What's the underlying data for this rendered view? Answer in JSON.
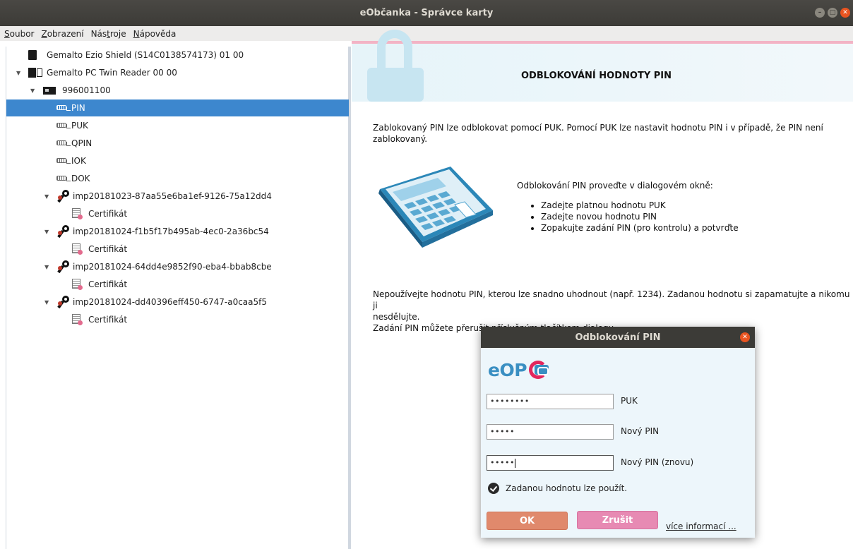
{
  "window": {
    "title": "eObčanka - Správce karty"
  },
  "menu": [
    {
      "key": "S",
      "rest": "oubor"
    },
    {
      "key": "Z",
      "rest": "obrazení"
    },
    {
      "pre": "Nás",
      "key": "t",
      "rest": "roje"
    },
    {
      "key": "N",
      "rest": "ápověda"
    }
  ],
  "tree": {
    "reader1": "Gemalto Ezio Shield (S14C0138574173) 01 00",
    "reader2": "Gemalto PC Twin Reader 00 00",
    "card": "996001100",
    "pins": [
      "PIN",
      "PUK",
      "QPIN",
      "IOK",
      "DOK"
    ],
    "keys": [
      {
        "name": "imp20181023-87aa55e6ba1ef-9126-75a12dd4",
        "cert": "Certifikát"
      },
      {
        "name": "imp20181024-f1b5f17b495ab-4ec0-2a36bc54",
        "cert": "Certifikát"
      },
      {
        "name": "imp20181024-64dd4e9852f90-eba4-bbab8cbe",
        "cert": "Certifikát"
      },
      {
        "name": "imp20181024-dd40396eff450-6747-a0caa5f5",
        "cert": "Certifikát"
      }
    ]
  },
  "content": {
    "title": "ODBLOKOVÁNÍ HODNOTY PIN",
    "intro_line1": "Zablokovaný PIN lze odblokovat pomocí PUK. Pomocí PUK lze nastavit hodnotu PIN i v případě, že PIN není",
    "intro_line2": "zablokovaný.",
    "steps_title": "Odblokování PIN proveďte v dialogovém okně:",
    "steps": [
      "Zadejte platnou hodnotu PUK",
      "Zadejte novou hodnotu PIN",
      "Zopakujte zadání PIN (pro kontrolu) a potvrďte"
    ],
    "warn_line1": "Nepoužívejte hodnotu PIN, kterou lze snadno uhodnout (např. 1234). Zadanou hodnotu si zapamatujte a nikomu ji",
    "warn_line2": "nesdělujte.",
    "warn_line3": "Zadání PIN můžete přerušit příslušným tlačítkem dialogu."
  },
  "dialog": {
    "title": "Odblokování PIN",
    "logo_text": "eOP",
    "puk_value": "••••••••",
    "puk_label": "PUK",
    "pin_value": "•••••",
    "pin_label": "Nový PIN",
    "pin2_value": "•••••",
    "pin2_label": "Nový PIN (znovu)",
    "status": "Zadanou hodnotu lze použít.",
    "ok": "OK",
    "cancel": "Zrušit",
    "more": "více informací ..."
  }
}
